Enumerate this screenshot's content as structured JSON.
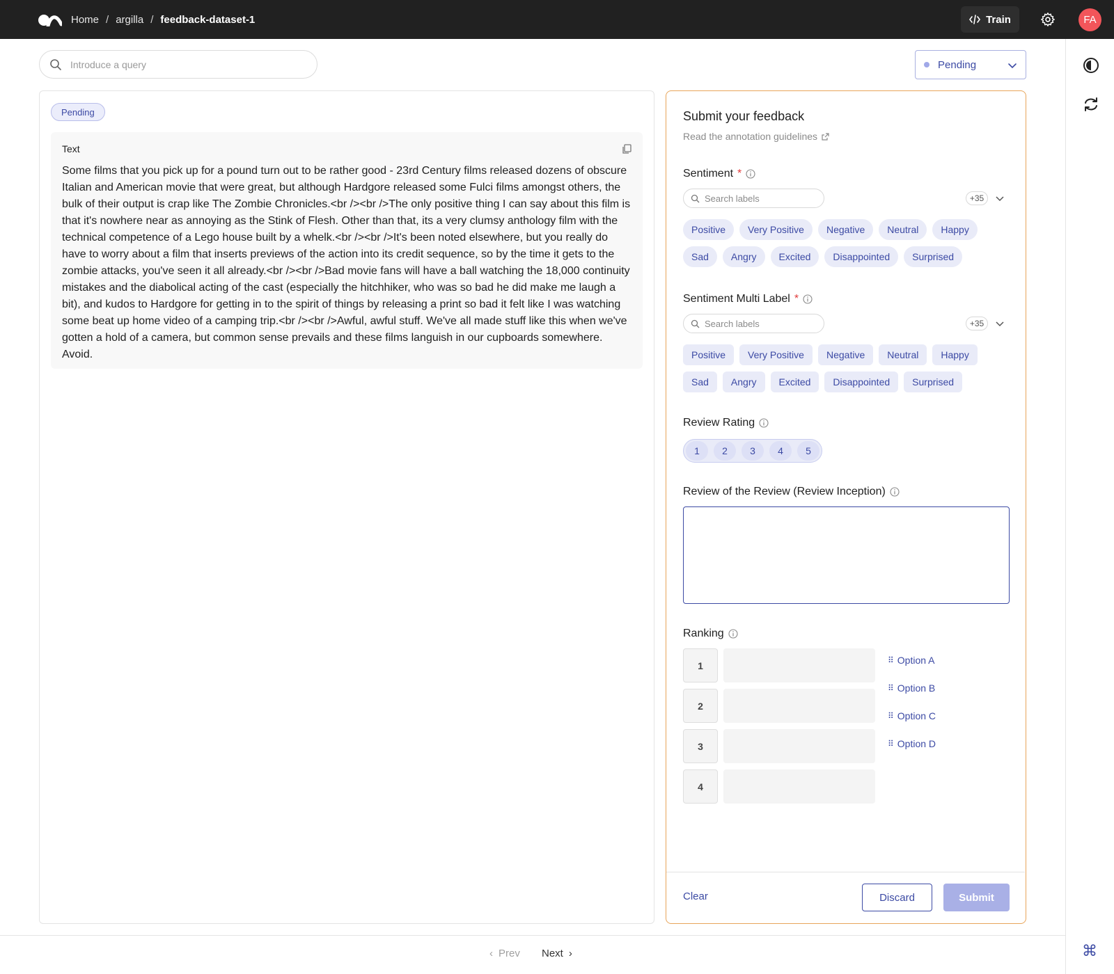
{
  "header": {
    "breadcrumbs": [
      "Home",
      "argilla",
      "feedback-dataset-1"
    ],
    "separator": "/",
    "train_label": "Train",
    "avatar_initials": "FA"
  },
  "search": {
    "placeholder": "Introduce a query"
  },
  "status_filter": {
    "selected": "Pending"
  },
  "record": {
    "status_badge": "Pending",
    "field_label": "Text",
    "field_text": "Some films that you pick up for a pound turn out to be rather good - 23rd Century films released dozens of obscure Italian and American movie that were great, but although Hardgore released some Fulci films amongst others, the bulk of their output is crap like The Zombie Chronicles.<br /><br />The only positive thing I can say about this film is that it's nowhere near as annoying as the Stink of Flesh. Other than that, its a very clumsy anthology film with the technical competence of a Lego house built by a whelk.<br /><br />It's been noted elsewhere, but you really do have to worry about a film that inserts previews of the action into its credit sequence, so by the time it gets to the zombie attacks, you've seen it all already.<br /><br />Bad movie fans will have a ball watching the 18,000 continuity mistakes and the diabolical acting of the cast (especially the hitchhiker, who was so bad he did make me laugh a bit), and kudos to Hardgore for getting in to the spirit of things by releasing a print so bad it felt like I was watching some beat up home video of a camping trip.<br /><br />Awful, awful stuff. We've all made stuff like this when we've gotten a hold of a camera, but common sense prevails and these films languish in our cupboards somewhere. Avoid."
  },
  "form": {
    "title": "Submit your feedback",
    "guidelines_link": "Read the annotation guidelines",
    "sentiment": {
      "title": "Sentiment",
      "required_mark": "*",
      "search_placeholder": "Search labels",
      "more_count": "+35",
      "labels": [
        "Positive",
        "Very Positive",
        "Negative",
        "Neutral",
        "Happy",
        "Sad",
        "Angry",
        "Excited",
        "Disappointed",
        "Surprised"
      ]
    },
    "sentiment_multi": {
      "title": "Sentiment Multi Label",
      "required_mark": "*",
      "search_placeholder": "Search labels",
      "more_count": "+35",
      "labels": [
        "Positive",
        "Very Positive",
        "Negative",
        "Neutral",
        "Happy",
        "Sad",
        "Angry",
        "Excited",
        "Disappointed",
        "Surprised"
      ]
    },
    "review_rating": {
      "title": "Review Rating",
      "options": [
        "1",
        "2",
        "3",
        "4",
        "5"
      ]
    },
    "review_of_review": {
      "title": "Review of the Review (Review Inception)",
      "value": ""
    },
    "ranking": {
      "title": "Ranking",
      "slots": [
        "1",
        "2",
        "3",
        "4"
      ],
      "options": [
        "Option A",
        "Option B",
        "Option C",
        "Option D"
      ]
    },
    "footer": {
      "clear_label": "Clear",
      "discard_label": "Discard",
      "submit_label": "Submit"
    }
  },
  "pager": {
    "prev_label": "Prev",
    "next_label": "Next"
  },
  "colors": {
    "accent": "#3c4aa4",
    "form_border": "#e8a55a",
    "avatar": "#f2555a",
    "topbar": "#212121"
  }
}
